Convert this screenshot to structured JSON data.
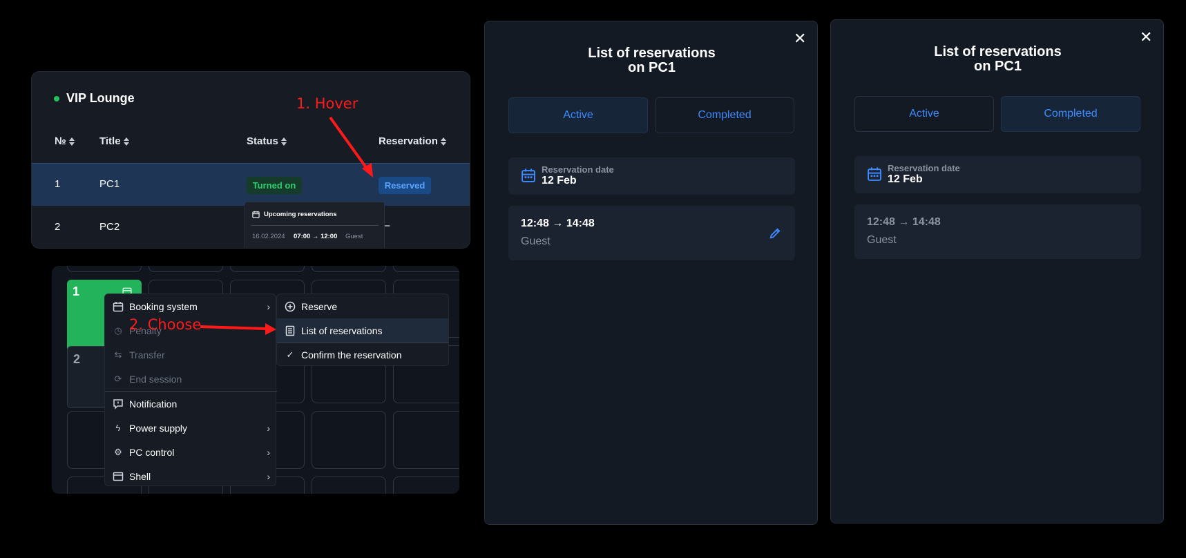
{
  "vip": {
    "title": "VIP Lounge",
    "headers": {
      "num": "№",
      "title": "Title",
      "status": "Status",
      "reservation": "Reservation"
    },
    "rows": [
      {
        "num": "1",
        "title": "PC1",
        "status": "Turned on",
        "reservation": "Reserved"
      },
      {
        "num": "2",
        "title": "PC2",
        "reservation": "–"
      }
    ],
    "tooltip": {
      "heading": "Upcoming reservations",
      "date": "16.02.2024",
      "time": "07:00 → 12:00",
      "user": "Guest"
    }
  },
  "grid": {
    "pc1": "1",
    "pc2": "2"
  },
  "context_menu": {
    "items": [
      {
        "label": "Booking system",
        "icon": "calendar-icon",
        "submenu": true
      },
      {
        "label": "Penalty",
        "icon": "clock-icon",
        "disabled": true
      },
      {
        "label": "Transfer",
        "icon": "transfer-icon",
        "disabled": true
      },
      {
        "label": "End session",
        "icon": "logout-icon",
        "disabled": true
      },
      {
        "label": "Notification",
        "icon": "message-icon"
      },
      {
        "label": "Power supply",
        "icon": "lightning-icon",
        "submenu": true
      },
      {
        "label": "PC control",
        "icon": "gear-icon",
        "submenu": true
      },
      {
        "label": "Shell",
        "icon": "window-icon",
        "submenu": true
      }
    ],
    "submenu": [
      {
        "label": "Reserve",
        "icon": "plus-circle-icon"
      },
      {
        "label": "List of reservations",
        "icon": "list-icon"
      },
      {
        "label": "Confirm the reservation",
        "icon": "check-icon"
      }
    ]
  },
  "annotations": {
    "hover": "1. Hover",
    "choose": "2. Choose"
  },
  "modal_active": {
    "title_line1": "List of reservations",
    "title_line2": "on PC1",
    "tabs": [
      "Active",
      "Completed"
    ],
    "selected_tab": "Active",
    "date_label": "Reservation date",
    "date_value": "12 Feb",
    "entry_time": "12:48 → 14:48",
    "entry_user": "Guest"
  },
  "modal_completed": {
    "title_line1": "List of reservations",
    "title_line2": "on PC1",
    "tabs": [
      "Active",
      "Completed"
    ],
    "selected_tab": "Completed",
    "date_label": "Reservation date",
    "date_value": "12 Feb",
    "entry_time": "12:48 → 14:48",
    "entry_user": "Guest"
  },
  "colors": {
    "accent": "#3d8bff",
    "success": "#23b45b",
    "annotation": "#ff1a1a",
    "background": "#000000"
  }
}
